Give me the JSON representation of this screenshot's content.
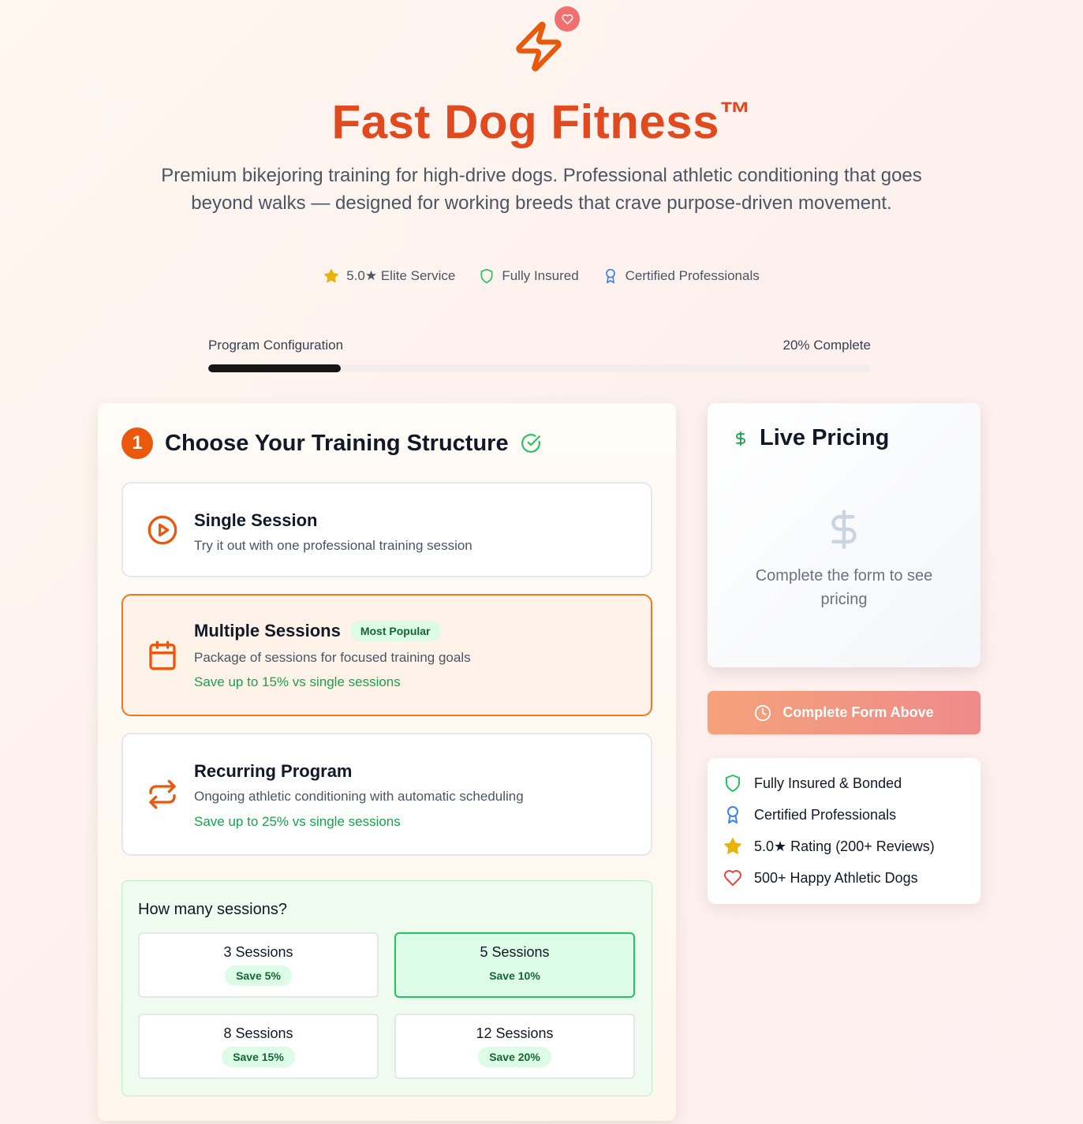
{
  "brand": {
    "title": "Fast Dog Fitness",
    "trademark": "™",
    "subtitle": "Premium bikejoring training for high-drive dogs. Professional athletic conditioning that goes beyond walks — designed for working breeds that crave purpose-driven movement."
  },
  "badges": [
    {
      "label": "5.0★ Elite Service",
      "icon": "star-icon"
    },
    {
      "label": "Fully Insured",
      "icon": "shield-icon"
    },
    {
      "label": "Certified Professionals",
      "icon": "award-icon"
    }
  ],
  "progress": {
    "label": "Program Configuration",
    "status": "20% Complete",
    "percent": 20
  },
  "step": {
    "number": "1",
    "title": "Choose Your Training Structure"
  },
  "options": [
    {
      "title": "Single Session",
      "desc": "Try it out with one professional training session",
      "save": "",
      "icon": "play-circle-icon"
    },
    {
      "title": "Multiple Sessions",
      "badge": "Most Popular",
      "desc": "Package of sessions for focused training goals",
      "save": "Save up to 15% vs single sessions",
      "icon": "calendar-icon",
      "selected": true
    },
    {
      "title": "Recurring Program",
      "desc": "Ongoing athletic conditioning with automatic scheduling",
      "save": "Save up to 25% vs single sessions",
      "icon": "repeat-icon"
    }
  ],
  "sessions": {
    "question": "How many sessions?",
    "choices": [
      {
        "label": "3 Sessions",
        "save": "Save 5%"
      },
      {
        "label": "5 Sessions",
        "save": "Save 10%",
        "selected": true
      },
      {
        "label": "8 Sessions",
        "save": "Save 15%"
      },
      {
        "label": "12 Sessions",
        "save": "Save 20%"
      }
    ]
  },
  "pricing": {
    "title": "Live Pricing",
    "empty_text": "Complete the form to see pricing"
  },
  "cta": {
    "label": "Complete Form Above"
  },
  "trust": [
    {
      "label": "Fully Insured & Bonded",
      "icon": "shield-icon"
    },
    {
      "label": "Certified Professionals",
      "icon": "award-icon"
    },
    {
      "label": "5.0★ Rating (200+ Reviews)",
      "icon": "star-icon"
    },
    {
      "label": "500+ Happy Athletic Dogs",
      "icon": "heart-icon"
    }
  ],
  "colors": {
    "brand_orange": "#e14a1e",
    "accent_orange": "#ea580c",
    "success_green": "#16a34a",
    "progress_fill": "#151515"
  }
}
